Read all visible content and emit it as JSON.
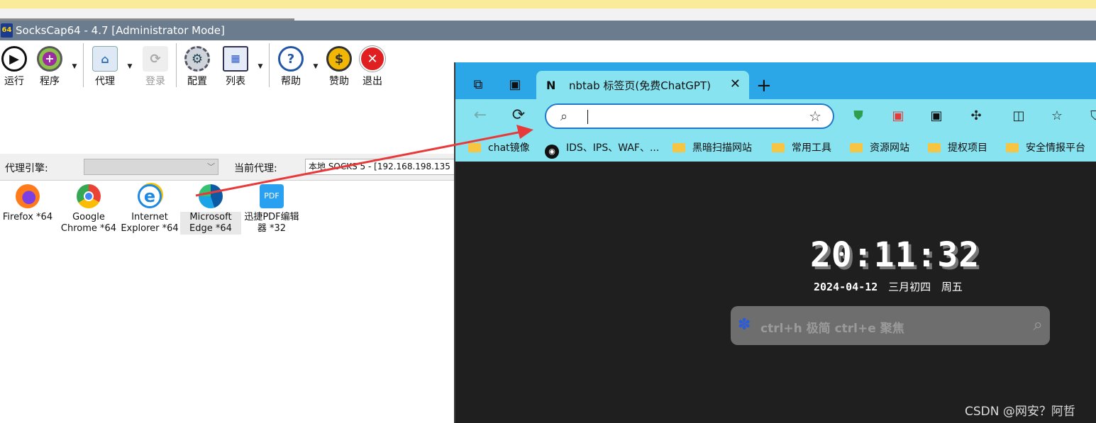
{
  "window": {
    "app_icon": "64",
    "title": "SocksCap64 - 4.7 [Administrator Mode]"
  },
  "toolbar": {
    "run": {
      "label": "运行",
      "icon": "play-icon"
    },
    "programs": {
      "label": "程序",
      "icon": "program-plus-icon"
    },
    "proxy": {
      "label": "代理",
      "icon": "proxy-network-icon"
    },
    "login": {
      "label": "登录",
      "icon": "refresh-login-icon"
    },
    "config": {
      "label": "配置",
      "icon": "gear-icon"
    },
    "list": {
      "label": "列表",
      "icon": "grid-list-icon"
    },
    "help": {
      "label": "帮助",
      "icon": "help-icon"
    },
    "sponsor": {
      "label": "赞助",
      "icon": "dollar-icon"
    },
    "exit": {
      "label": "退出",
      "icon": "close-icon"
    },
    "dropdown_glyph": "▼"
  },
  "proxy_bar": {
    "engine_label": "代理引擎:",
    "engine_value": "",
    "current_label": "当前代理:",
    "current_value": "本地   SOCKS 5 - [192.168.198.135"
  },
  "apps": [
    {
      "label": "Firefox *64",
      "icon": "firefox-icon"
    },
    {
      "label": "Google Chrome *64",
      "icon": "chrome-icon"
    },
    {
      "label": "Internet Explorer *64",
      "icon": "internet-explorer-icon"
    },
    {
      "label": "Microsoft Edge *64",
      "icon": "edge-icon"
    },
    {
      "label": "迅捷PDF编辑器 *32",
      "icon": "pdf-editor-icon"
    }
  ],
  "browser": {
    "tab_title": "nbtab 标签页(免费ChatGPT)",
    "tab_favicon": "N",
    "new_tab": "+",
    "close_tab": "✕",
    "address_value": "",
    "bookmarks": [
      {
        "label": "chat镜像",
        "icon": "folder-icon"
      },
      {
        "label": "IDS、IPS、WAF、...",
        "icon": "github-icon"
      },
      {
        "label": "黑暗扫描网站",
        "icon": "folder-icon"
      },
      {
        "label": "常用工具",
        "icon": "folder-icon"
      },
      {
        "label": "资源网站",
        "icon": "folder-icon"
      },
      {
        "label": "提权项目",
        "icon": "folder-icon"
      },
      {
        "label": "安全情报平台",
        "icon": "folder-icon"
      }
    ],
    "clock": "20:11:32",
    "date": "2024-04-12",
    "lunar": "三月初四",
    "weekday": "周五",
    "search_placeholder": "ctrl+h 极简  ctrl+e 聚焦",
    "search_engine_icon": "baidu-icon",
    "watermark": "CSDN @网安？阿哲"
  },
  "colors": {
    "titlebar": "#6b7c8f",
    "tabstrip": "#2ba6e6",
    "toolbar_bg": "#86e3ef",
    "annotation_arrow": "#e83a3a"
  }
}
